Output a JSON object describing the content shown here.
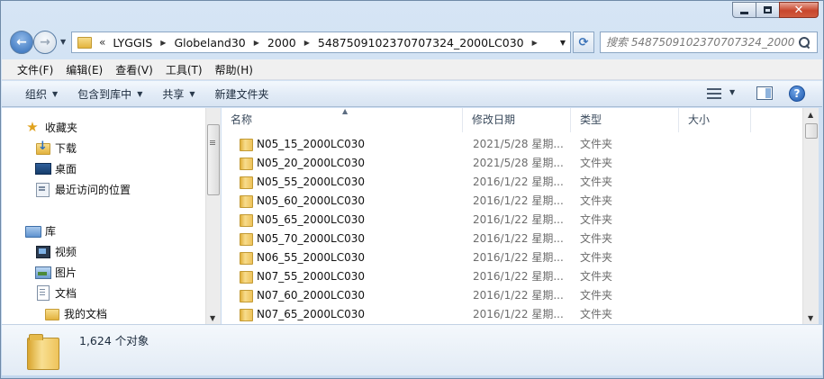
{
  "window": {
    "caption_minimize": "–",
    "caption_maximize": "□",
    "caption_close": "✕"
  },
  "nav": {
    "back_icon": "back-arrow",
    "forward_icon": "forward-arrow",
    "back_glyph": "←",
    "forward_glyph": "→",
    "history_glyph": "▼"
  },
  "address": {
    "lead": "«",
    "sep": "▶",
    "crumbs": [
      "LYGGIS",
      "Globeland30",
      "2000",
      "5487509102370707324_2000LC030"
    ],
    "dropdown": "▼",
    "refresh": "⟳"
  },
  "search": {
    "placeholder": "搜索 5487509102370707324_2000..."
  },
  "menu": [
    "文件(F)",
    "编辑(E)",
    "查看(V)",
    "工具(T)",
    "帮助(H)"
  ],
  "commands": {
    "organize": "组织",
    "include_library": "包含到库中",
    "share": "共享",
    "new_folder": "新建文件夹",
    "caret": "▼",
    "help": "?"
  },
  "navpane": {
    "favorites": "收藏夹",
    "downloads": "下载",
    "desktop": "桌面",
    "recent": "最近访问的位置",
    "libraries": "库",
    "videos": "视频",
    "pictures": "图片",
    "documents": "文档",
    "my_documents": "我的文档",
    "star_glyph": "★",
    "scroll_down": "▼",
    "grip_glyph": "≡"
  },
  "filelist": {
    "columns": [
      "名称",
      "修改日期",
      "类型",
      "大小"
    ],
    "sort_caret": "▲",
    "rows": [
      {
        "name": "N05_15_2000LC030",
        "date": "2021/5/28 星期...",
        "type": "文件夹"
      },
      {
        "name": "N05_20_2000LC030",
        "date": "2021/5/28 星期...",
        "type": "文件夹"
      },
      {
        "name": "N05_55_2000LC030",
        "date": "2016/1/22 星期...",
        "type": "文件夹"
      },
      {
        "name": "N05_60_2000LC030",
        "date": "2016/1/22 星期...",
        "type": "文件夹"
      },
      {
        "name": "N05_65_2000LC030",
        "date": "2016/1/22 星期...",
        "type": "文件夹"
      },
      {
        "name": "N05_70_2000LC030",
        "date": "2016/1/22 星期...",
        "type": "文件夹"
      },
      {
        "name": "N06_55_2000LC030",
        "date": "2016/1/22 星期...",
        "type": "文件夹"
      },
      {
        "name": "N07_55_2000LC030",
        "date": "2016/1/22 星期...",
        "type": "文件夹"
      },
      {
        "name": "N07_60_2000LC030",
        "date": "2016/1/22 星期...",
        "type": "文件夹"
      },
      {
        "name": "N07_65_2000LC030",
        "date": "2016/1/22 星期...",
        "type": "文件夹"
      }
    ],
    "scroll_up": "▲",
    "scroll_down": "▼"
  },
  "details": {
    "count": "1,624 个对象"
  }
}
